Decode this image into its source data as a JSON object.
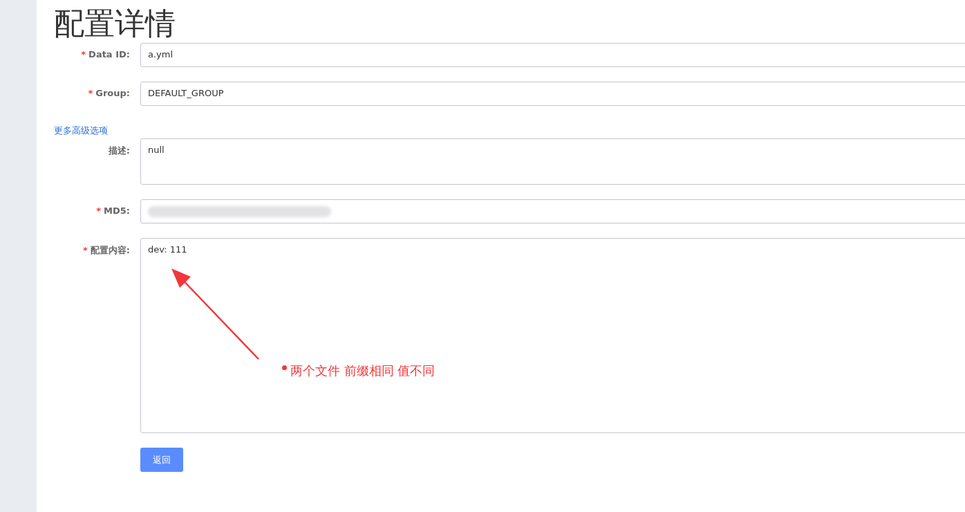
{
  "title": "配置详情",
  "fields": [
    {
      "kind": "input",
      "label": "Data ID:",
      "required_mark": "*",
      "value": "a.yml"
    },
    {
      "kind": "input",
      "label": "Group:",
      "required_mark": "*",
      "value": "DEFAULT_GROUP"
    },
    {
      "kind": "link",
      "label": "更多高级选项"
    },
    {
      "kind": "textarea",
      "label": "描述:",
      "value": "null"
    },
    {
      "kind": "input",
      "label": "MD5:",
      "required_mark": "*",
      "redacted": true
    },
    {
      "kind": "editor",
      "label": "配置内容:",
      "required_mark": "*",
      "value": "dev: 111",
      "annotation": "两个文件 前缀相同 值不同"
    }
  ],
  "buttons": [
    "返回"
  ]
}
